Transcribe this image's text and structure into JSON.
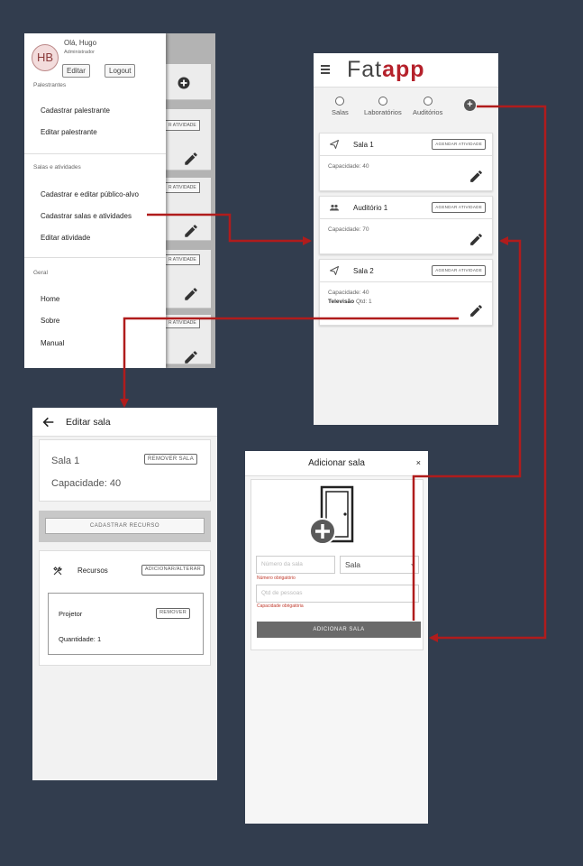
{
  "colors": {
    "background": "#323d4e",
    "accent": "#b5212b",
    "connector": "#b01c1c"
  },
  "drawer_screen": {
    "avatar_initials": "HB",
    "greeting": "Olá, Hugo",
    "role": "Administrador",
    "edit_button": "Editar",
    "logout_button": "Logout",
    "sections": [
      {
        "title": "Palestrantes",
        "items": [
          "Cadastrar palestrante",
          "Editar palestrante"
        ]
      },
      {
        "title": "Salas e atividades",
        "items": [
          "Cadastrar e editar público-alvo",
          "Cadastrar salas e atividades",
          "Editar atividade"
        ]
      },
      {
        "title": "Geral",
        "items": [
          "Home",
          "Sobre",
          "Manual"
        ]
      }
    ],
    "background_chip": "R ATIVIDADE"
  },
  "list_screen": {
    "menu_icon": "hamburger-icon",
    "logo_part1": "Fat",
    "logo_part2": "app",
    "tabs": [
      "Salas",
      "Laboratórios",
      "Auditórios"
    ],
    "add_icon": "plus-circle-icon",
    "rooms": [
      {
        "name": "Sala 1",
        "icon": "send-icon",
        "button": "AGENDAR ATIVIDADE",
        "capacity": "Capacidade: 40",
        "resource_label": "",
        "resource_qty": ""
      },
      {
        "name": "Auditório 1",
        "icon": "people-icon",
        "button": "AGENDAR ATIVIDADE",
        "capacity": "Capacidade: 70",
        "resource_label": "",
        "resource_qty": ""
      },
      {
        "name": "Sala 2",
        "icon": "send-icon",
        "button": "AGENDAR ATIVIDADE",
        "capacity": "Capacidade: 40",
        "resource_label": "Televisão",
        "resource_qty": " Qtd: 1"
      }
    ]
  },
  "edit_screen": {
    "title": "Editar sala",
    "room_name": "Sala 1",
    "remove_room_button": "REMOVER SALA",
    "capacity": "Capacidade: 40",
    "register_resource_button": "CADASTRAR RECURSO",
    "resources_label": "Recursos",
    "resources_button": "ADICIONAR/ALTERAR",
    "resource_item": {
      "name": "Projetor",
      "remove_button": "REMOVER",
      "quantity": "Quantidade: 1"
    }
  },
  "add_screen": {
    "title": "Adicionar sala",
    "close_label": "×",
    "room_number_placeholder": "Número da sala",
    "room_type_value": "Sala",
    "room_number_error": "Número obrigatório",
    "people_placeholder": "Qtd de pessoas",
    "capacity_error": "Capacidade obrigatória",
    "submit_button": "ADICIONAR SALA"
  }
}
